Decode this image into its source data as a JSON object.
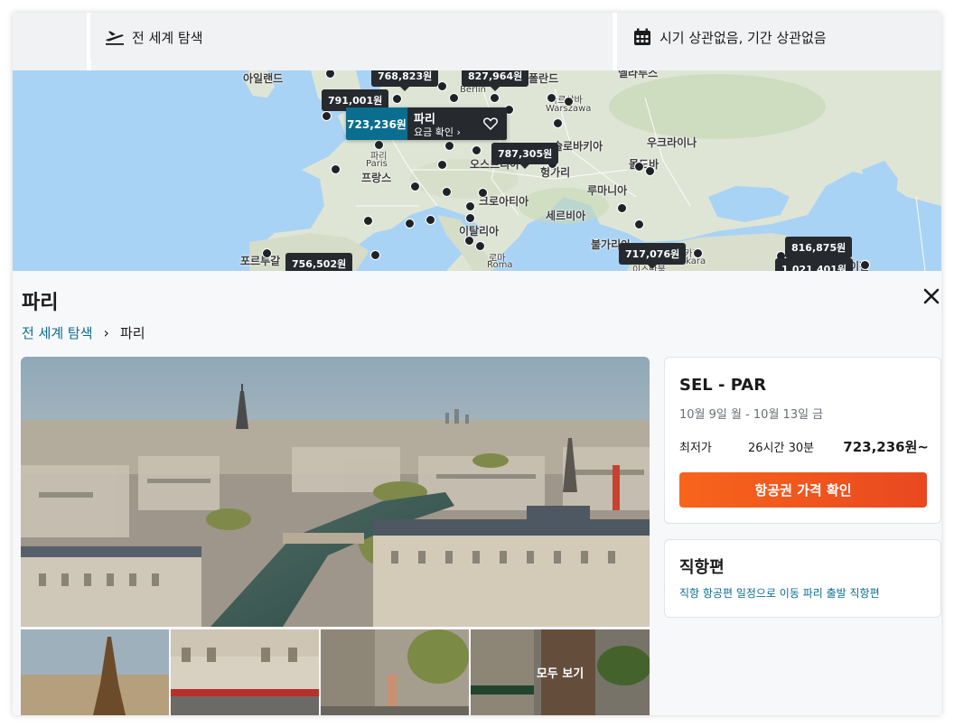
{
  "search": {
    "destination": "전 세계 탐색",
    "dates": "시기 상관없음, 기간 상관없음",
    "icons": {
      "departure": "plane-departure-icon",
      "calendar": "calendar-icon"
    }
  },
  "map": {
    "countries": [
      "아일랜드",
      "폴란드",
      "벨라루스",
      "우크라이나",
      "몰도바",
      "루마니아",
      "세르비아",
      "헝가리",
      "오스트리아",
      "크로아티아",
      "이탈리아",
      "프랑스",
      "포르투갈",
      "불가리아",
      "슬로바키아"
    ],
    "cities": [
      "Berlin",
      "바르샤바",
      "Warszawa",
      "파리",
      "Paris",
      "로마",
      "Roma",
      "앙카라",
      "Ankara",
      "이스탄불",
      "아제르바이잔"
    ],
    "price_tags": [
      "768,823원",
      "827,964원",
      "791,001원",
      "787,305원",
      "756,502원",
      "717,076원",
      "816,875원",
      "1,021,401원"
    ],
    "selected": {
      "price": "723,236원",
      "city": "파리",
      "cta": "요금 확인 ›"
    }
  },
  "detail": {
    "title": "파리",
    "breadcrumb": [
      "전 세계 탐색",
      "파리"
    ],
    "breadcrumb_sep": "›",
    "gallery": {
      "see_all": "모두 보기"
    },
    "flight": {
      "route": "SEL - PAR",
      "dates": "10월 9일 월 - 10월 13일 금",
      "lowest_label": "최저가",
      "duration": "26시간 30분",
      "price": "723,236원~",
      "cta": "항공권 가격 확인"
    },
    "direct": {
      "title": "직항편",
      "link": "직항 항공편 일정으로 이동 파리 출발 직항편"
    }
  },
  "colors": {
    "accent": "#0b6e8f",
    "cta_start": "#f7651c",
    "cta_end": "#e94820",
    "tag_dark": "#262a2f"
  }
}
